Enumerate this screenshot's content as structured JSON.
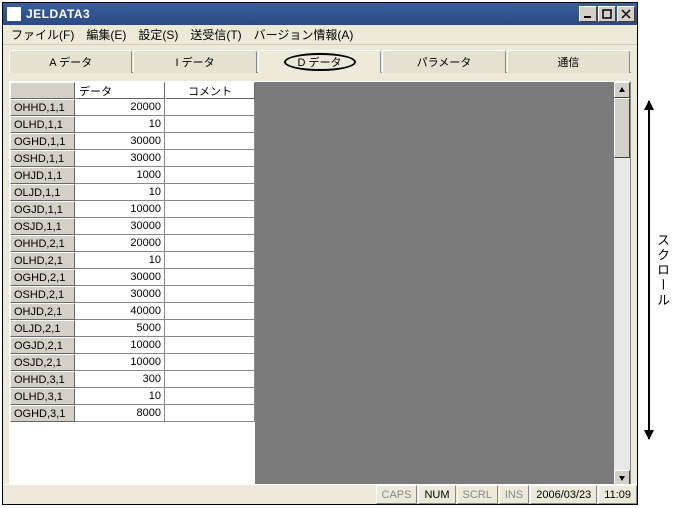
{
  "window": {
    "title": "JELDATA3"
  },
  "menu": {
    "file": "ファイル(F)",
    "edit": "編集(E)",
    "settings": "設定(S)",
    "transfer": "送受信(T)",
    "version": "バージョン情報(A)"
  },
  "tabs": {
    "a": "A データ",
    "i": "I データ",
    "d": "D データ",
    "param": "パラメータ",
    "comm": "通信",
    "active": "d"
  },
  "grid": {
    "headers": {
      "rowhead": "",
      "data": "データ",
      "comment": "コメント"
    },
    "rows": [
      {
        "id": "OHHD,1,1",
        "value": "20000",
        "comment": ""
      },
      {
        "id": "OLHD,1,1",
        "value": "10",
        "comment": ""
      },
      {
        "id": "OGHD,1,1",
        "value": "30000",
        "comment": ""
      },
      {
        "id": "OSHD,1,1",
        "value": "30000",
        "comment": ""
      },
      {
        "id": "OHJD,1,1",
        "value": "1000",
        "comment": ""
      },
      {
        "id": "OLJD,1,1",
        "value": "10",
        "comment": ""
      },
      {
        "id": "OGJD,1,1",
        "value": "10000",
        "comment": ""
      },
      {
        "id": "OSJD,1,1",
        "value": "30000",
        "comment": ""
      },
      {
        "id": "OHHD,2,1",
        "value": "20000",
        "comment": ""
      },
      {
        "id": "OLHD,2,1",
        "value": "10",
        "comment": ""
      },
      {
        "id": "OGHD,2,1",
        "value": "30000",
        "comment": ""
      },
      {
        "id": "OSHD,2,1",
        "value": "30000",
        "comment": ""
      },
      {
        "id": "OHJD,2,1",
        "value": "40000",
        "comment": ""
      },
      {
        "id": "OLJD,2,1",
        "value": "5000",
        "comment": ""
      },
      {
        "id": "OGJD,2,1",
        "value": "10000",
        "comment": ""
      },
      {
        "id": "OSJD,2,1",
        "value": "10000",
        "comment": ""
      },
      {
        "id": "OHHD,3,1",
        "value": "300",
        "comment": ""
      },
      {
        "id": "OLHD,3,1",
        "value": "10",
        "comment": ""
      },
      {
        "id": "OGHD,3,1",
        "value": "8000",
        "comment": ""
      }
    ]
  },
  "status": {
    "caps": "CAPS",
    "num": "NUM",
    "scrl": "SCRL",
    "ins": "INS",
    "date": "2006/03/23",
    "time": "11:09"
  },
  "annotation": {
    "label": "スクロール"
  }
}
